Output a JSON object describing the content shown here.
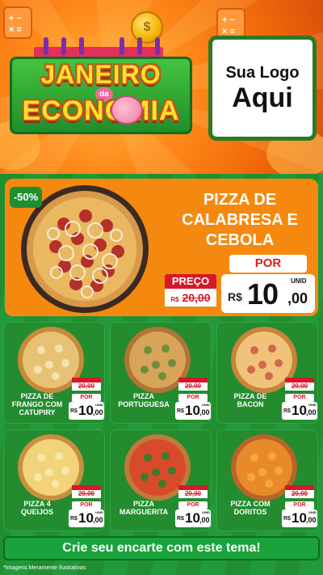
{
  "header": {
    "title_line1": "JANEIRO",
    "title_de": "da",
    "title_line2": "ECONOMIA",
    "logo_line1": "Sua Logo",
    "logo_line2": "Aqui",
    "coin_symbol": "$"
  },
  "featured": {
    "discount": "-50%",
    "name_line1": "PIZZA DE",
    "name_line2": "CALABRESA E",
    "name_line3": "CEBOLA",
    "por_label": "POR",
    "preco_label": "PREÇO",
    "old_currency": "R$",
    "old_price": "20,00",
    "currency": "R$",
    "price_int": "10",
    "price_cents": ",00",
    "unit": "UNID"
  },
  "products": [
    {
      "name_line1": "PIZZA DE",
      "name_line2": "FRANGO COM",
      "name_line3": "CATUPIRY",
      "old_label": "PREÇO",
      "old_price": "20,00",
      "por": "POR",
      "currency": "R$",
      "price_int": "10",
      "price_cents": ",00",
      "unit": "UNID"
    },
    {
      "name_line1": "PIZZA",
      "name_line2": "PORTUGUESA",
      "name_line3": "",
      "old_label": "PREÇO",
      "old_price": "20,00",
      "por": "POR",
      "currency": "R$",
      "price_int": "10",
      "price_cents": ",00",
      "unit": "UNID"
    },
    {
      "name_line1": "PIZZA DE",
      "name_line2": "BACON",
      "name_line3": "",
      "old_label": "PREÇO",
      "old_price": "20,00",
      "por": "POR",
      "currency": "R$",
      "price_int": "10",
      "price_cents": ",00",
      "unit": "UNID"
    },
    {
      "name_line1": "PIZZA 4",
      "name_line2": "QUEIJOS",
      "name_line3": "",
      "old_label": "PREÇO",
      "old_price": "20,00",
      "por": "POR",
      "currency": "R$",
      "price_int": "10",
      "price_cents": ",00",
      "unit": "UNID"
    },
    {
      "name_line1": "PIZZA",
      "name_line2": "MARGUERITA",
      "name_line3": "",
      "old_label": "PREÇO",
      "old_price": "20,00",
      "por": "POR",
      "currency": "R$",
      "price_int": "10",
      "price_cents": ",00",
      "unit": "UNID"
    },
    {
      "name_line1": "PIZZA COM",
      "name_line2": "DORITOS",
      "name_line3": "",
      "old_label": "PREÇO",
      "old_price": "20,00",
      "por": "POR",
      "currency": "R$",
      "price_int": "10",
      "price_cents": ",00",
      "unit": "UNID"
    }
  ],
  "cta": {
    "label": "Crie seu encarte com este tema!"
  },
  "footnote": "*Imagens Meramente Ilustrativas",
  "colors": {
    "header_orange": "#f26a0a",
    "panel_green": "#1f8f2f",
    "feature_orange": "#f5890f",
    "price_red": "#d6182a",
    "title_yellow": "#ffe02a"
  },
  "icons": [
    "calculator-icon",
    "coin-icon",
    "piggy-bank-icon"
  ]
}
